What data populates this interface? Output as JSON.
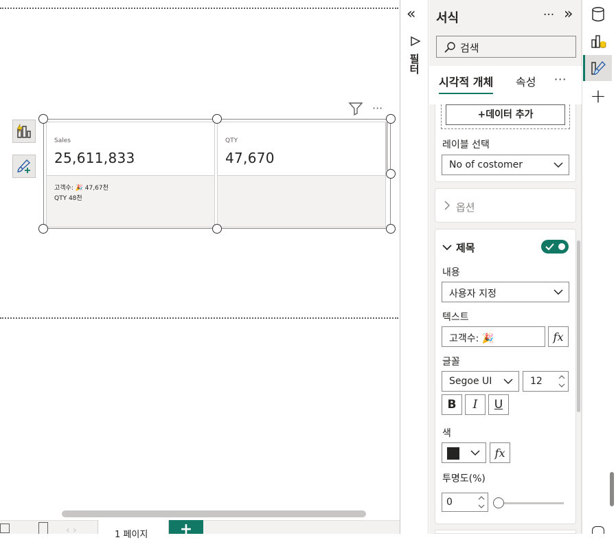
{
  "canvas": {
    "cards": [
      {
        "label": "Sales",
        "value": "25,611,833",
        "lines": [
          "고객수: 🎉 47,67천",
          "QTY 48천"
        ]
      },
      {
        "label": "QTY",
        "value": "47,670",
        "lines": []
      }
    ],
    "page_tab": "1 페이지",
    "add_page": "+"
  },
  "filter_pane": {
    "label": "필터"
  },
  "format_pane": {
    "title": "서식",
    "more": "···",
    "search_placeholder": "검색",
    "tabs": {
      "visual": "시각적 개체",
      "properties": "속성",
      "more": "···"
    },
    "data": {
      "add_data": "+데이터 추가",
      "label_select_label": "레이블 선택",
      "label_select_value": "No of costomer"
    },
    "options": {
      "title": "옵션"
    },
    "title_section": {
      "title": "제목",
      "toggle_on": true,
      "content_label": "내용",
      "content_value": "사용자 지정",
      "text_label": "텍스트",
      "text_value": "고객수: 🎉",
      "fx": "fx",
      "font_label": "글꼴",
      "font_family": "Segoe UI",
      "font_size": "12",
      "bold": "B",
      "italic": "I",
      "underline": "U",
      "color_label": "색",
      "color_value": "#252423",
      "transparency_label": "투명도(%)",
      "transparency_value": "0",
      "transparency_level": 0
    }
  },
  "colors": {
    "accent": "#117865",
    "pane_bg": "#f3f2f1"
  }
}
